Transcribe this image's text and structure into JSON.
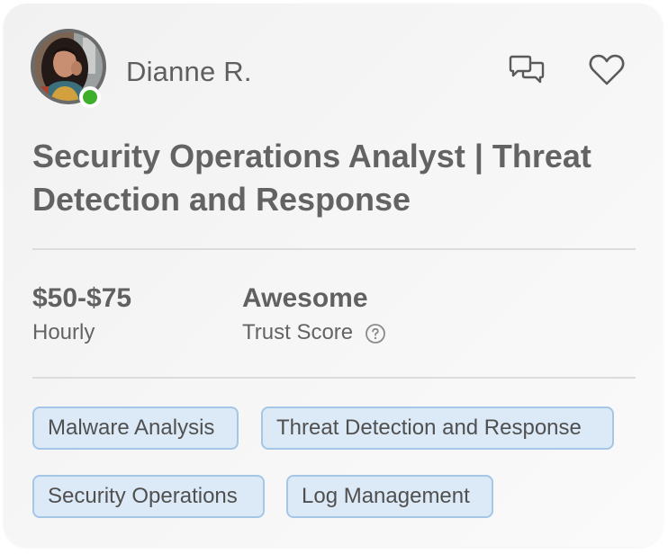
{
  "profile": {
    "name": "Dianne R.",
    "online": true
  },
  "actions": {
    "message_icon": "chat-bubbles-icon",
    "favorite_icon": "heart-outline-icon"
  },
  "job_title": "Security Operations Analyst | Threat Detection and Response",
  "rate": {
    "value": "$50-$75",
    "label": "Hourly"
  },
  "trust": {
    "value": "Awesome",
    "label": "Trust Score",
    "help_icon": "question-circle-icon"
  },
  "skills": [
    "Malware Analysis",
    "Threat Detection and Response",
    "Security Operations",
    "Log Management"
  ],
  "colors": {
    "online": "#3fae2a",
    "tag_bg": "#dce9f6",
    "tag_border": "#a6c6e6",
    "text": "#5f5f5f"
  }
}
